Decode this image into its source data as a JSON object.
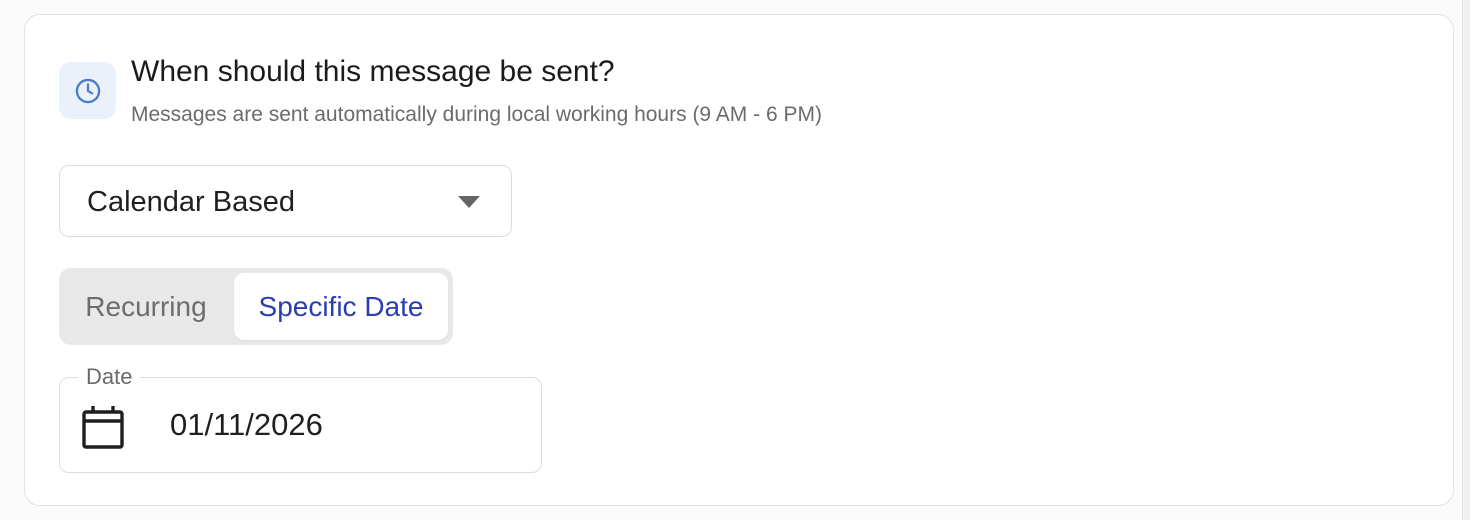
{
  "schedule": {
    "icon": "clock-icon",
    "title": "When should this message be sent?",
    "subtitle": "Messages are sent automatically during local working hours (9 AM - 6 PM)",
    "schedule_type": {
      "selected": "Calendar Based",
      "icon": "chevron-down-icon"
    },
    "mode_toggle": {
      "options": [
        "Recurring",
        "Specific Date"
      ],
      "selected": "Specific Date"
    },
    "date_field": {
      "label": "Date",
      "value": "01/11/2026",
      "icon": "calendar-icon"
    }
  },
  "colors": {
    "accent": "#2a3eb1",
    "icon_tile_bg": "#eaf1fa",
    "clock_icon": "#4a7fc6"
  }
}
